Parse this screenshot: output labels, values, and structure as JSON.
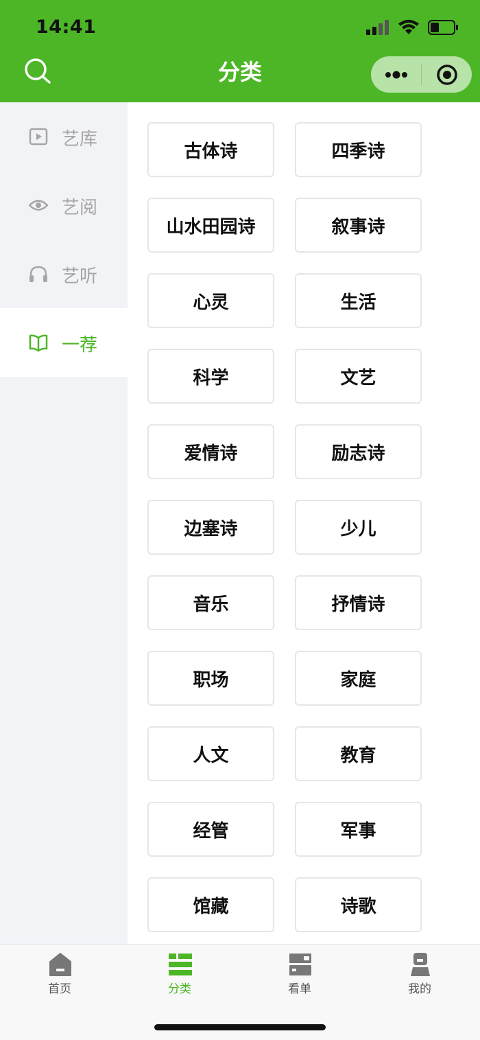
{
  "status_bar": {
    "time": "14:41"
  },
  "header": {
    "title": "分类"
  },
  "sidebar": {
    "items": [
      {
        "label": "艺库",
        "icon": "video-icon",
        "active": false
      },
      {
        "label": "艺阅",
        "icon": "eye-icon",
        "active": false
      },
      {
        "label": "艺听",
        "icon": "headphones-icon",
        "active": false
      },
      {
        "label": "一荐",
        "icon": "book-icon",
        "active": true
      }
    ]
  },
  "categories": [
    "古体诗",
    "四季诗",
    "山水田园诗",
    "叙事诗",
    "心灵",
    "生活",
    "科学",
    "文艺",
    "爱情诗",
    "励志诗",
    "边塞诗",
    "少儿",
    "音乐",
    "抒情诗",
    "职场",
    "家庭",
    "人文",
    "教育",
    "经管",
    "军事",
    "馆藏",
    "诗歌"
  ],
  "tabbar": {
    "items": [
      {
        "label": "首页",
        "icon": "home-icon",
        "active": false
      },
      {
        "label": "分类",
        "icon": "category-list-icon",
        "active": true
      },
      {
        "label": "看单",
        "icon": "watchlist-icon",
        "active": false
      },
      {
        "label": "我的",
        "icon": "profile-icon",
        "active": false
      }
    ]
  },
  "colors": {
    "brand": "#4cb626",
    "sidebar_bg": "#f2f3f7",
    "inactive": "#a6a6a6"
  }
}
